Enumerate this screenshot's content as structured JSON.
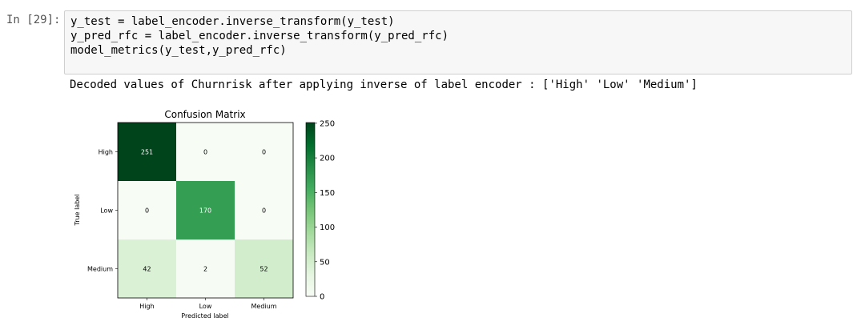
{
  "prompt": "In [29]:",
  "code_lines": [
    "y_test = label_encoder.inverse_transform(y_test)",
    "y_pred_rfc = label_encoder.inverse_transform(y_pred_rfc)",
    "model_metrics(y_test,y_pred_rfc)"
  ],
  "output_text": "Decoded values of Churnrisk after applying inverse of label encoder : ['High' 'Low' 'Medium']",
  "chart_data": {
    "type": "heatmap",
    "title": "Confusion Matrix",
    "xlabel": "Predicted label",
    "ylabel": "True label",
    "x_categories": [
      "High",
      "Low",
      "Medium"
    ],
    "y_categories": [
      "High",
      "Low",
      "Medium"
    ],
    "values": [
      [
        251,
        0,
        0
      ],
      [
        0,
        170,
        0
      ],
      [
        42,
        2,
        52
      ]
    ],
    "colorbar": {
      "min": 0,
      "max": 251,
      "ticks": [
        0,
        50,
        100,
        150,
        200,
        250
      ],
      "colormap": "Greens"
    }
  }
}
